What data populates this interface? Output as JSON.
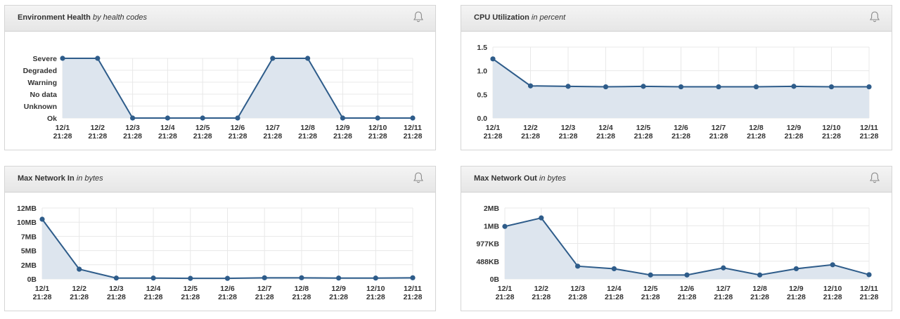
{
  "colors": {
    "line": "#2e5c8a",
    "area": "#dde5ee",
    "grid": "#e8e8e8",
    "header": "#ececec"
  },
  "icons": {
    "alarm": "bell-icon"
  },
  "panels": [
    {
      "title": "Environment Health",
      "subtitle": "by health codes",
      "chart_data": {
        "type": "area",
        "x": [
          "12/1 21:28",
          "12/2 21:28",
          "12/3 21:28",
          "12/4 21:28",
          "12/5 21:28",
          "12/6 21:28",
          "12/7 21:28",
          "12/8 21:28",
          "12/9 21:28",
          "12/10 21:28",
          "12/11 21:28"
        ],
        "y_categories": [
          "Ok",
          "Unknown",
          "No data",
          "Warning",
          "Degraded",
          "Severe"
        ],
        "values": [
          "Severe",
          "Severe",
          "Ok",
          "Ok",
          "Ok",
          "Ok",
          "Severe",
          "Severe",
          "Ok",
          "Ok",
          "Ok"
        ]
      }
    },
    {
      "title": "CPU Utilization",
      "subtitle": "in percent",
      "chart_data": {
        "type": "area",
        "x": [
          "12/1 21:28",
          "12/2 21:28",
          "12/3 21:28",
          "12/4 21:28",
          "12/5 21:28",
          "12/6 21:28",
          "12/7 21:28",
          "12/8 21:28",
          "12/9 21:28",
          "12/10 21:28",
          "12/11 21:28"
        ],
        "yticks": [
          "0.0",
          "0.5",
          "1.0",
          "1.5"
        ],
        "ylim": [
          0,
          1.5
        ],
        "values": [
          1.25,
          0.68,
          0.67,
          0.66,
          0.67,
          0.66,
          0.66,
          0.66,
          0.67,
          0.66,
          0.66
        ]
      }
    },
    {
      "title": "Max Network In",
      "subtitle": "in bytes",
      "chart_data": {
        "type": "area",
        "x": [
          "12/1 21:28",
          "12/2 21:28",
          "12/3 21:28",
          "12/4 21:28",
          "12/5 21:28",
          "12/6 21:28",
          "12/7 21:28",
          "12/8 21:28",
          "12/9 21:28",
          "12/10 21:28",
          "12/11 21:28"
        ],
        "yticks": [
          "0B",
          "2MB",
          "5MB",
          "7MB",
          "10MB",
          "12MB"
        ],
        "ylim": [
          0,
          12
        ],
        "values": [
          10.1,
          1.65,
          0.15,
          0.15,
          0.1,
          0.1,
          0.2,
          0.2,
          0.15,
          0.15,
          0.2
        ]
      }
    },
    {
      "title": "Max Network Out",
      "subtitle": "in bytes",
      "chart_data": {
        "type": "area",
        "x": [
          "12/1 21:28",
          "12/2 21:28",
          "12/3 21:28",
          "12/4 21:28",
          "12/5 21:28",
          "12/6 21:28",
          "12/7 21:28",
          "12/8 21:28",
          "12/9 21:28",
          "12/10 21:28",
          "12/11 21:28"
        ],
        "yticks": [
          "0B",
          "488KB",
          "977KB",
          "1MB",
          "2MB"
        ],
        "ylim": [
          0,
          2.5
        ],
        "values": [
          1.85,
          2.15,
          0.45,
          0.36,
          0.14,
          0.14,
          0.39,
          0.14,
          0.36,
          0.5,
          0.15
        ]
      }
    }
  ]
}
